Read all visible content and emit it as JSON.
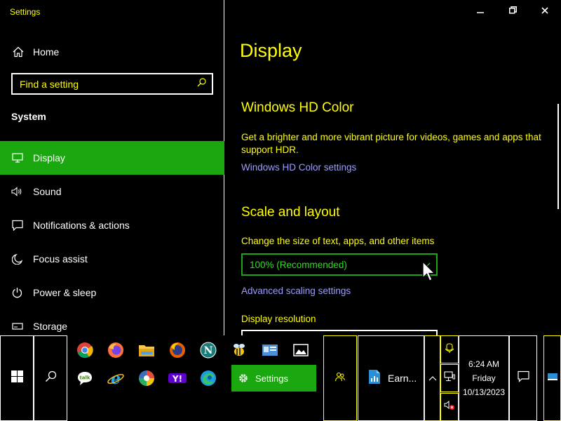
{
  "window": {
    "app_title": "Settings"
  },
  "sidebar": {
    "home_label": "Home",
    "search_placeholder": "Find a setting",
    "section_heading": "System",
    "items": [
      {
        "label": "Display",
        "icon": "monitor-icon",
        "active": true
      },
      {
        "label": "Sound",
        "icon": "speaker-icon"
      },
      {
        "label": "Notifications & actions",
        "icon": "notification-icon"
      },
      {
        "label": "Focus assist",
        "icon": "moon-icon"
      },
      {
        "label": "Power & sleep",
        "icon": "power-icon"
      },
      {
        "label": "Storage",
        "icon": "storage-icon"
      }
    ]
  },
  "main": {
    "page_title": "Display",
    "hd_color": {
      "heading": "Windows HD Color",
      "description": "Get a brighter and more vibrant picture for videos, games and apps that support HDR.",
      "link": "Windows HD Color settings"
    },
    "scale": {
      "heading": "Scale and layout",
      "label": "Change the size of text, apps, and other items",
      "selected_value": "100% (Recommended)",
      "advanced_link": "Advanced scaling settings",
      "resolution_label": "Display resolution"
    }
  },
  "taskbar": {
    "pinned_apps": [
      "chrome-icon",
      "firefox-icon",
      "file-explorer-icon",
      "firefox-alt-icon",
      "netscape-icon",
      "bee-icon",
      "contact-card-icon",
      "photos-icon",
      "talk-icon",
      "internet-explorer-icon",
      "orb-icon",
      "yahoo-icon",
      "edge-icon"
    ],
    "active_task_label": "Settings",
    "earn_task_label": "Earn...",
    "clock": {
      "time": "6:24 AM",
      "day": "Friday",
      "date": "10/13/2023"
    }
  },
  "colors": {
    "accent_green": "#1aa70f",
    "text_yellow": "#ffff00",
    "link_purple": "#9d9dff",
    "background": "#000000"
  }
}
